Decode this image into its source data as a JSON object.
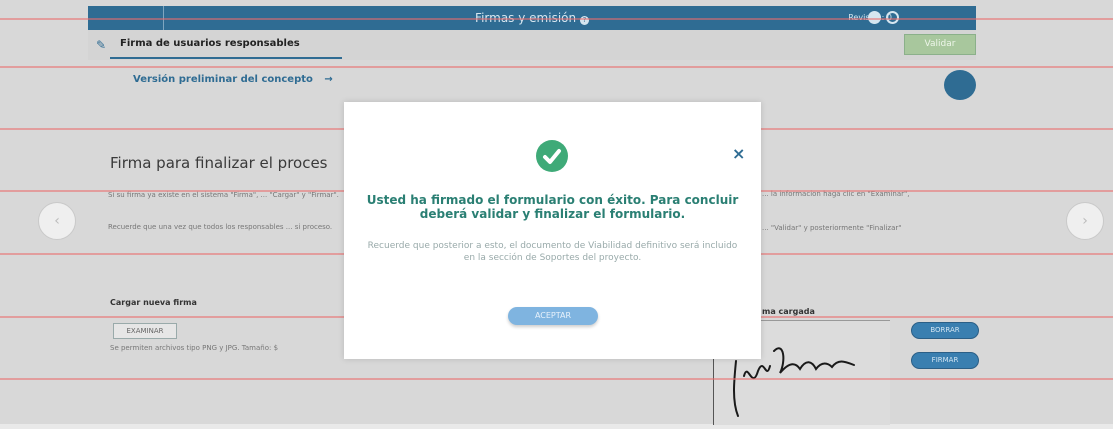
{
  "header": {
    "title": "Firmas y emisión",
    "revision": "Revisión: 0"
  },
  "tab": {
    "label": "Firma de usuarios responsables"
  },
  "toolbar": {
    "validar_label": "Validar"
  },
  "preliminary": {
    "label": "Versión preliminar del concepto",
    "arrow": "→"
  },
  "side_button": {
    "label": ""
  },
  "main": {
    "heading": "Firma para finalizar el proces",
    "paragraph1": "Si su firma ya existe en el sistema \"Firma\", ... \"Cargar\" y \"Firmar\".",
    "paragraph2": "Recuerde que una vez que todos los responsables ... si proceso.",
    "paragraph_right1": "... la informacion haga clic en \"Examinar\",",
    "paragraph_right2": "... \"Validar\" y posteriormente \"Finalizar\""
  },
  "upload": {
    "label": "Cargar nueva firma",
    "button": "EXAMINAR",
    "hint": "Se permiten archivos tipo PNG y JPG. Tamaño: $"
  },
  "uploaded": {
    "label": "ma cargada",
    "delete_button": "BORRAR",
    "sign_button": "FIRMAR"
  },
  "modal": {
    "message": "Usted ha firmado el formulario con éxito. Para concluir deberá validar y finalizar el formulario.",
    "subtext": "Recuerde que posterior a esto, el documento de Viabilidad definitivo será incluido en la sección de Soportes del proyecto.",
    "accept": "ACEPTAR",
    "close": "×"
  },
  "nav": {
    "prev": "‹",
    "next": "›"
  },
  "colors": {
    "primary": "#2f6c93",
    "success": "#3faa78",
    "message": "#2a7f73",
    "validar": "#a8c79d"
  }
}
